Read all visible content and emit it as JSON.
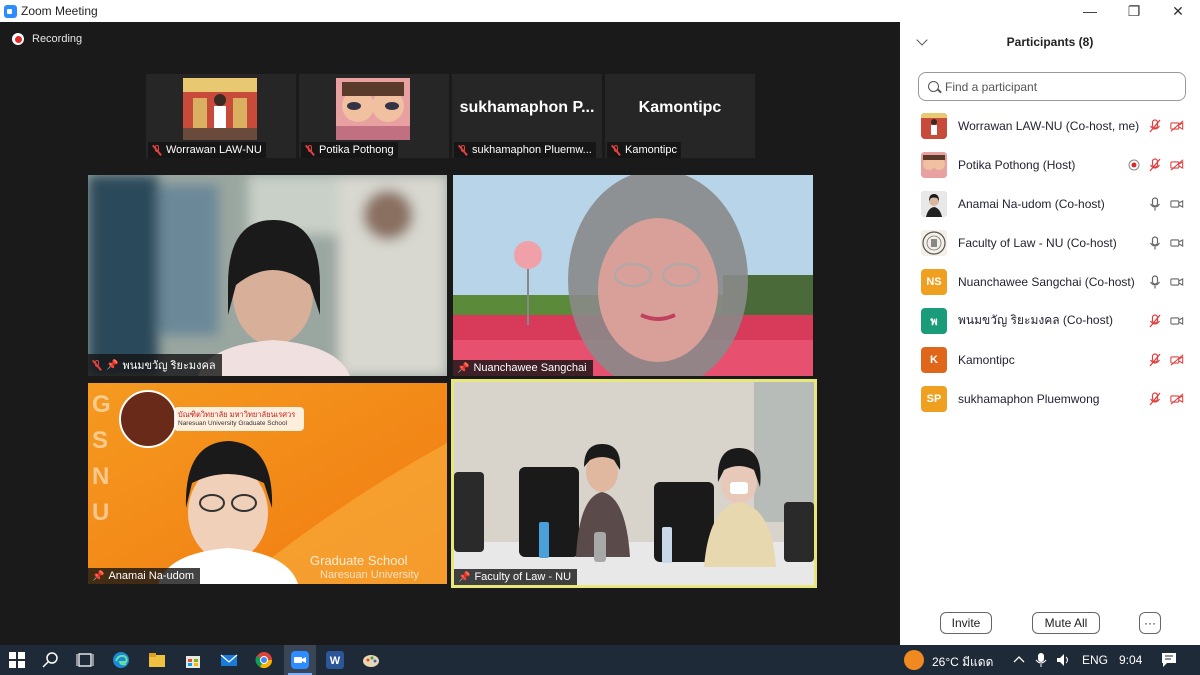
{
  "window": {
    "title": "Zoom Meeting",
    "minimize": "—",
    "restore": "❐",
    "close": "✕"
  },
  "recording": {
    "label": "Recording"
  },
  "thumbnails": [
    {
      "name": "Worrawan LAW-NU",
      "muted": true,
      "kind": "photo"
    },
    {
      "name": "Potika Pothong",
      "muted": true,
      "kind": "photo"
    },
    {
      "name": "sukhamaphon Pluemw...",
      "display_name": "sukhamaphon  P...",
      "muted": true,
      "kind": "text"
    },
    {
      "name": "Kamontipc",
      "display_name": "Kamontipc",
      "muted": true,
      "kind": "text"
    }
  ],
  "tiles": [
    {
      "name": "พนมขวัญ ริยะมงคล",
      "muted": true,
      "pinned": true
    },
    {
      "name": "Nuanchawee Sangchai",
      "muted": false,
      "pinned": true
    },
    {
      "name": "Anamai Na-udom",
      "muted": false,
      "pinned": true,
      "bg_text_1": "บัณฑิตวิทยาลัย มหาวิทยาลัยนเรศวร",
      "bg_text_2": "Naresuan University Graduate School",
      "bg_text_3": "Graduate School",
      "bg_text_4": "Naresuan University",
      "bg_letters": [
        "G",
        "S",
        "N",
        "U"
      ]
    },
    {
      "name": "Faculty of Law - NU",
      "muted": false,
      "pinned": true,
      "active_speaker": true
    }
  ],
  "participants_panel": {
    "title": "Participants (8)",
    "search_placeholder": "Find a participant",
    "participants": [
      {
        "name": "Worrawan LAW-NU (Co-host, me)",
        "initials": "",
        "avatar_color": "#b8b0a8",
        "mic": "off",
        "video": "off",
        "recording": false
      },
      {
        "name": "Potika Pothong (Host)",
        "initials": "",
        "avatar_color": "#d8a0a0",
        "mic": "off",
        "video": "off",
        "recording": true
      },
      {
        "name": "Anamai Na-udom (Co-host)",
        "initials": "",
        "avatar_color": "#9a9a9a",
        "mic": "on",
        "video": "on",
        "recording": false
      },
      {
        "name": "Faculty of Law - NU (Co-host)",
        "initials": "",
        "avatar_color": "#c8c0b0",
        "mic": "on",
        "video": "on",
        "recording": false
      },
      {
        "name": "Nuanchawee Sangchai (Co-host)",
        "initials": "NS",
        "avatar_color": "#f0a020",
        "mic": "on",
        "video": "on",
        "recording": false
      },
      {
        "name": "พนมขวัญ ริยะมงคล (Co-host)",
        "initials": "พ",
        "avatar_color": "#1a9c7a",
        "mic": "off",
        "video": "on",
        "recording": false
      },
      {
        "name": "Kamontipc",
        "initials": "K",
        "avatar_color": "#e0661a",
        "mic": "off",
        "video": "off",
        "recording": false
      },
      {
        "name": "sukhamaphon Pluemwong",
        "initials": "SP",
        "avatar_color": "#f0a020",
        "mic": "off",
        "video": "off",
        "recording": false
      }
    ],
    "buttons": {
      "invite": "Invite",
      "mute_all": "Mute All",
      "more": "···"
    }
  },
  "taskbar": {
    "apps": [
      "windows-start",
      "search",
      "task-view",
      "edge",
      "file-explorer",
      "store",
      "mail",
      "chrome",
      "zoom",
      "word",
      "paint"
    ],
    "weather": "26°C มีแดด",
    "language": "ENG",
    "time": "9:04"
  },
  "colors": {
    "accent_yellow": "#e8e87a",
    "mute_red": "#e04040",
    "zoom_blue": "#2d8cff"
  }
}
